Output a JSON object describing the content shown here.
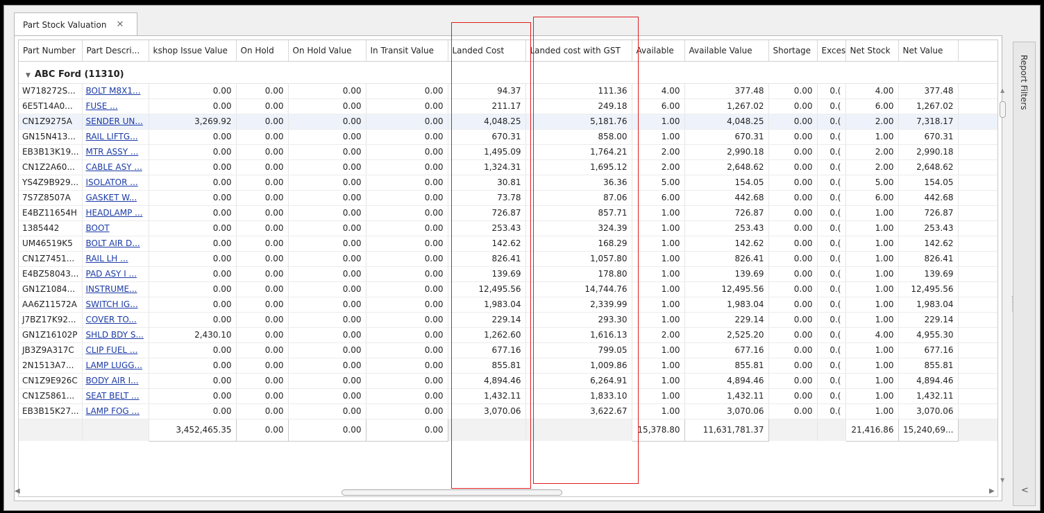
{
  "tab": {
    "title": "Part Stock Valuation",
    "close_glyph": "✕"
  },
  "columns": [
    "Part Number",
    "Part Descri...",
    "kshop Issue Value",
    "On Hold",
    "On Hold Value",
    "In Transit Value",
    "Landed Cost",
    "Landed cost with GST",
    "Available",
    "Available Value",
    "Shortage",
    "Excess",
    "Net Stock",
    "Net Value"
  ],
  "group": {
    "label": "ABC Ford (11310)",
    "expand_glyph": "▼"
  },
  "rows": [
    [
      "W718272S...",
      "BOLT M8X1...",
      "0.00",
      "0.00",
      "0.00",
      "0.00",
      "94.37",
      "111.36",
      "4.00",
      "377.48",
      "0.00",
      "0.(",
      "4.00",
      "377.48"
    ],
    [
      "6E5T14A0...",
      "FUSE          ...",
      "0.00",
      "0.00",
      "0.00",
      "0.00",
      "211.17",
      "249.18",
      "6.00",
      "1,267.02",
      "0.00",
      "0.(",
      "6.00",
      "1,267.02"
    ],
    [
      "CN1Z9275A",
      "SENDER UN...",
      "3,269.92",
      "0.00",
      "0.00",
      "0.00",
      "4,048.25",
      "5,181.76",
      "1.00",
      "4,048.25",
      "0.00",
      "0.(",
      "2.00",
      "7,318.17"
    ],
    [
      "GN15N413...",
      "RAIL LIFTG...",
      "0.00",
      "0.00",
      "0.00",
      "0.00",
      "670.31",
      "858.00",
      "1.00",
      "670.31",
      "0.00",
      "0.(",
      "1.00",
      "670.31"
    ],
    [
      "EB3B13K19...",
      "MTR ASSY ...",
      "0.00",
      "0.00",
      "0.00",
      "0.00",
      "1,495.09",
      "1,764.21",
      "2.00",
      "2,990.18",
      "0.00",
      "0.(",
      "2.00",
      "2,990.18"
    ],
    [
      "CN1Z2A60...",
      "CABLE ASY ...",
      "0.00",
      "0.00",
      "0.00",
      "0.00",
      "1,324.31",
      "1,695.12",
      "2.00",
      "2,648.62",
      "0.00",
      "0.(",
      "2.00",
      "2,648.62"
    ],
    [
      "YS4Z9B929...",
      "ISOLATOR ...",
      "0.00",
      "0.00",
      "0.00",
      "0.00",
      "30.81",
      "36.36",
      "5.00",
      "154.05",
      "0.00",
      "0.(",
      "5.00",
      "154.05"
    ],
    [
      "7S7Z8507A",
      "GASKET W...",
      "0.00",
      "0.00",
      "0.00",
      "0.00",
      "73.78",
      "87.06",
      "6.00",
      "442.68",
      "0.00",
      "0.(",
      "6.00",
      "442.68"
    ],
    [
      "E4BZ11654H",
      "HEADLAMP ...",
      "0.00",
      "0.00",
      "0.00",
      "0.00",
      "726.87",
      "857.71",
      "1.00",
      "726.87",
      "0.00",
      "0.(",
      "1.00",
      "726.87"
    ],
    [
      "1385442",
      "BOOT",
      "0.00",
      "0.00",
      "0.00",
      "0.00",
      "253.43",
      "324.39",
      "1.00",
      "253.43",
      "0.00",
      "0.(",
      "1.00",
      "253.43"
    ],
    [
      "UM46519K5",
      "BOLT AIR D...",
      "0.00",
      "0.00",
      "0.00",
      "0.00",
      "142.62",
      "168.29",
      "1.00",
      "142.62",
      "0.00",
      "0.(",
      "1.00",
      "142.62"
    ],
    [
      "CN1Z7451...",
      "RAIL LH       ...",
      "0.00",
      "0.00",
      "0.00",
      "0.00",
      "826.41",
      "1,057.80",
      "1.00",
      "826.41",
      "0.00",
      "0.(",
      "1.00",
      "826.41"
    ],
    [
      "E4BZ58043...",
      "PAD ASY I ...",
      "0.00",
      "0.00",
      "0.00",
      "0.00",
      "139.69",
      "178.80",
      "1.00",
      "139.69",
      "0.00",
      "0.(",
      "1.00",
      "139.69"
    ],
    [
      "GN1Z1084...",
      "INSTRUME...",
      "0.00",
      "0.00",
      "0.00",
      "0.00",
      "12,495.56",
      "14,744.76",
      "1.00",
      "12,495.56",
      "0.00",
      "0.(",
      "1.00",
      "12,495.56"
    ],
    [
      "AA6Z11572A",
      "SWITCH IG...",
      "0.00",
      "0.00",
      "0.00",
      "0.00",
      "1,983.04",
      "2,339.99",
      "1.00",
      "1,983.04",
      "0.00",
      "0.(",
      "1.00",
      "1,983.04"
    ],
    [
      "J7BZ17K92...",
      "COVER TO...",
      "0.00",
      "0.00",
      "0.00",
      "0.00",
      "229.14",
      "293.30",
      "1.00",
      "229.14",
      "0.00",
      "0.(",
      "1.00",
      "229.14"
    ],
    [
      "GN1Z16102P",
      "SHLD BDY S...",
      "2,430.10",
      "0.00",
      "0.00",
      "0.00",
      "1,262.60",
      "1,616.13",
      "2.00",
      "2,525.20",
      "0.00",
      "0.(",
      "4.00",
      "4,955.30"
    ],
    [
      "JB3Z9A317C",
      "CLIP FUEL ...",
      "0.00",
      "0.00",
      "0.00",
      "0.00",
      "677.16",
      "799.05",
      "1.00",
      "677.16",
      "0.00",
      "0.(",
      "1.00",
      "677.16"
    ],
    [
      "2N1513A7...",
      "LAMP LUGG...",
      "0.00",
      "0.00",
      "0.00",
      "0.00",
      "855.81",
      "1,009.86",
      "1.00",
      "855.81",
      "0.00",
      "0.(",
      "1.00",
      "855.81"
    ],
    [
      "CN1Z9E926C",
      "BODY AIR I...",
      "0.00",
      "0.00",
      "0.00",
      "0.00",
      "4,894.46",
      "6,264.91",
      "1.00",
      "4,894.46",
      "0.00",
      "0.(",
      "1.00",
      "4,894.46"
    ],
    [
      "CN1Z5861...",
      "SEAT BELT ...",
      "0.00",
      "0.00",
      "0.00",
      "0.00",
      "1,432.11",
      "1,833.10",
      "1.00",
      "1,432.11",
      "0.00",
      "0.(",
      "1.00",
      "1,432.11"
    ],
    [
      "EB3B15K27...",
      "LAMP FOG ...",
      "0.00",
      "0.00",
      "0.00",
      "0.00",
      "3,070.06",
      "3,622.67",
      "1.00",
      "3,070.06",
      "0.00",
      "0.(",
      "1.00",
      "3,070.06"
    ]
  ],
  "selected_row": 2,
  "totals": [
    "",
    "",
    "3,452,465.35",
    "0.00",
    "0.00",
    "0.00",
    "",
    "",
    "15,378.80",
    "11,631,781.37",
    "",
    "",
    "21,416.86",
    "15,240,69..."
  ],
  "side_panel": {
    "label": "Report Filters",
    "collapse_glyph": "<"
  },
  "scroll_glyphs": {
    "up": "▲",
    "down": "▼",
    "left": "◀",
    "right": "▶"
  },
  "colors": {
    "highlight": "#e01b1b",
    "link": "#1b3aa6"
  }
}
